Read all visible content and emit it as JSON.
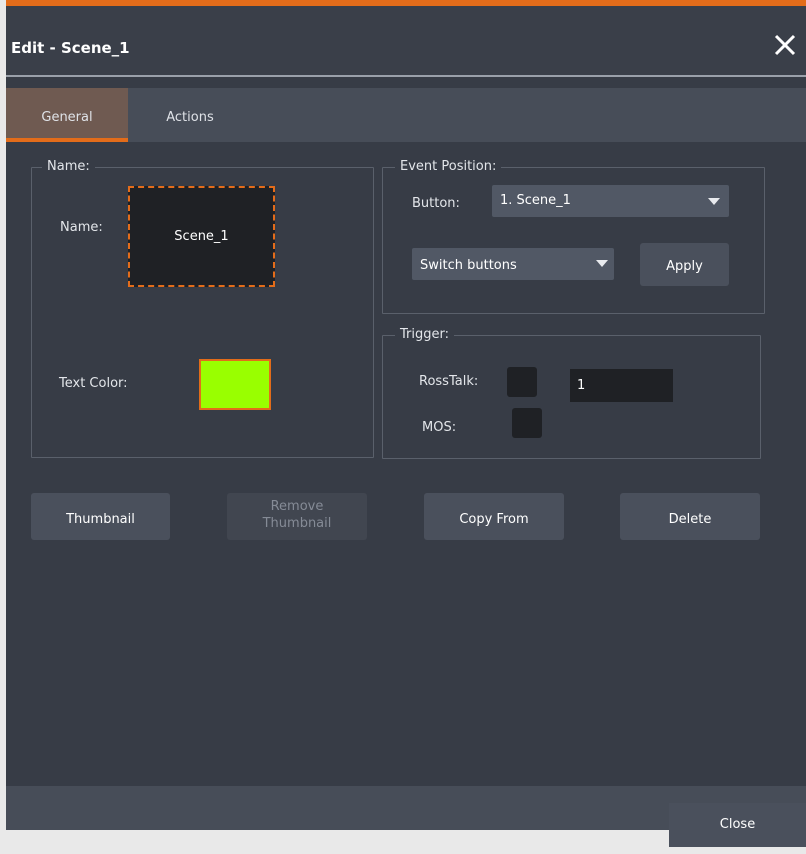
{
  "dialog": {
    "title": "Edit - Scene_1",
    "close_icon": "close-icon"
  },
  "tabs": [
    {
      "label": "General",
      "active": true
    },
    {
      "label": "Actions",
      "active": false
    }
  ],
  "name_group": {
    "legend": "Name:",
    "name_label": "Name:",
    "name_value": "Scene_1",
    "text_color_label": "Text Color:",
    "text_color": "#99ff00"
  },
  "event_position": {
    "legend": "Event Position:",
    "button_label": "Button:",
    "button_value": "1. Scene_1",
    "mode_value": "Switch buttons",
    "apply_label": "Apply"
  },
  "trigger": {
    "legend": "Trigger:",
    "rosstalk_label": "RossTalk:",
    "rosstalk_value": "1",
    "mos_label": "MOS:"
  },
  "actions": {
    "thumbnail": "Thumbnail",
    "remove_thumbnail_1": "Remove",
    "remove_thumbnail_2": "Thumbnail",
    "copy_from": "Copy From",
    "delete": "Delete"
  },
  "footer": {
    "close": "Close"
  },
  "colors": {
    "accent": "#e36c1a",
    "background": "#373c46"
  }
}
